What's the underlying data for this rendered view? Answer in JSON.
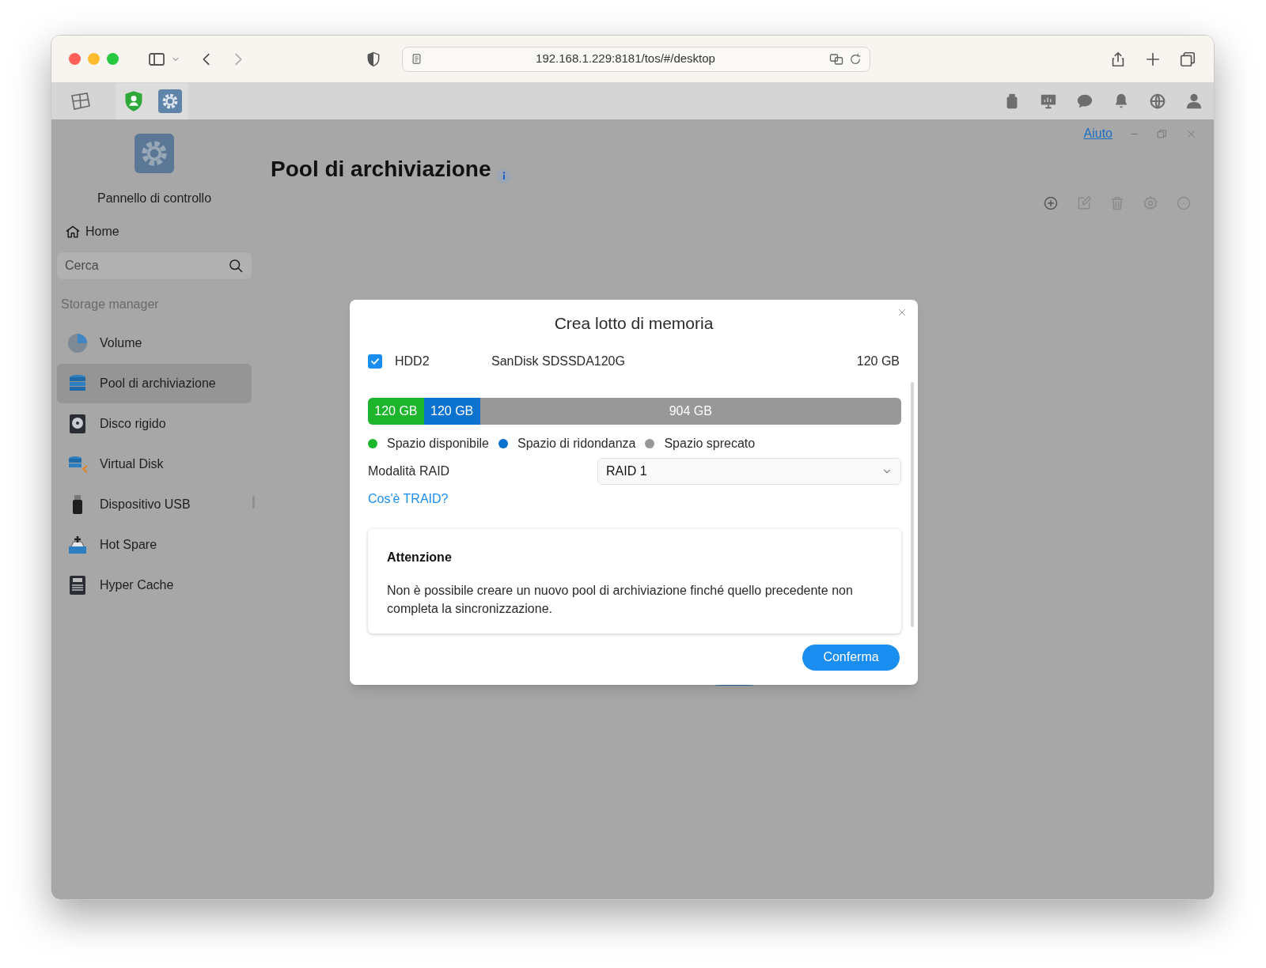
{
  "browser": {
    "url": "192.168.1.229:8181/tos/#/desktop"
  },
  "app": {
    "help_link": "Aiuto",
    "page_title": "Pool di archiviazione"
  },
  "sidebar": {
    "app_title": "Pannello di controllo",
    "home": "Home",
    "search": {
      "placeholder": "Cerca"
    },
    "section": "Storage manager",
    "items": [
      {
        "label": "Volume",
        "selected": false
      },
      {
        "label": "Pool di archiviazione",
        "selected": true
      },
      {
        "label": "Disco rigido",
        "selected": false
      },
      {
        "label": "Virtual Disk",
        "selected": false
      },
      {
        "label": "Dispositivo USB",
        "selected": false
      },
      {
        "label": "Hot Spare",
        "selected": false
      },
      {
        "label": "Hyper Cache",
        "selected": false
      }
    ]
  },
  "dialog": {
    "title": "Crea lotto di memoria",
    "disk": {
      "checked": true,
      "id": "HDD2",
      "model": "SanDisk SDSSDA120G",
      "size": "120 GB"
    },
    "capacity_bar": [
      {
        "label": "120 GB",
        "level": 0.105,
        "color": "#1db52b"
      },
      {
        "label": "120 GB",
        "level": 0.105,
        "color": "#0b72d0"
      },
      {
        "label": "904 GB",
        "level": 0.79,
        "color": "#989898"
      }
    ],
    "legend": [
      {
        "label": "Spazio disponibile",
        "color": "#1db52b"
      },
      {
        "label": "Spazio di ridondanza",
        "color": "#0b72d0"
      },
      {
        "label": "Spazio sprecato",
        "color": "#989898"
      }
    ],
    "raid": {
      "label": "Modalità RAID",
      "value": "RAID 1"
    },
    "link": "Cos'è TRAID?",
    "notice": {
      "title": "Attenzione",
      "text": "Non è possibile creare un nuovo pool di archiviazione finché quello precedente non completa la sincronizzazione."
    },
    "button": "Conferma"
  }
}
